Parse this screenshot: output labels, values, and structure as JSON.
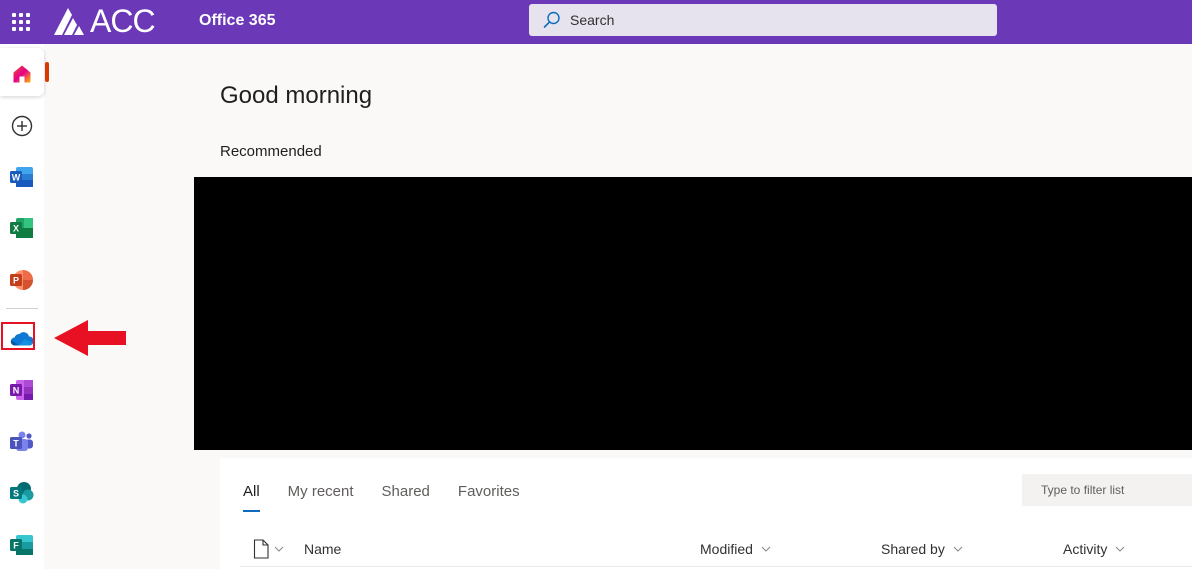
{
  "header": {
    "logo_text": "ACC",
    "app_name": "Office 365",
    "search_placeholder": "Search",
    "background_color": "#6b38b8"
  },
  "rail": {
    "items": [
      {
        "name": "home",
        "icon": "home-icon"
      },
      {
        "name": "create",
        "icon": "add-circle-icon"
      },
      {
        "name": "word",
        "icon": "word-icon",
        "letter": "W",
        "color": "#185abd"
      },
      {
        "name": "excel",
        "icon": "excel-icon",
        "letter": "X",
        "color": "#107c41"
      },
      {
        "name": "powerpoint",
        "icon": "powerpoint-icon",
        "letter": "P",
        "color": "#c43e1c"
      },
      {
        "name": "onedrive",
        "icon": "onedrive-icon",
        "color": "#0f78d4"
      },
      {
        "name": "onenote",
        "icon": "onenote-icon",
        "letter": "N",
        "color": "#7719aa"
      },
      {
        "name": "teams",
        "icon": "teams-icon",
        "color": "#5b5fc7"
      },
      {
        "name": "sharepoint",
        "icon": "sharepoint-icon",
        "letter": "S",
        "color": "#038387"
      },
      {
        "name": "forms",
        "icon": "forms-icon",
        "letter": "F",
        "color": "#077568"
      }
    ]
  },
  "main": {
    "greeting": "Good morning",
    "recommended_label": "Recommended"
  },
  "files": {
    "tabs": [
      {
        "label": "All",
        "active": true
      },
      {
        "label": "My recent",
        "active": false
      },
      {
        "label": "Shared",
        "active": false
      },
      {
        "label": "Favorites",
        "active": false
      }
    ],
    "filter_placeholder": "Type to filter list",
    "columns": {
      "name": "Name",
      "modified": "Modified",
      "shared_by": "Shared by",
      "activity": "Activity"
    }
  },
  "annotation": {
    "highlight_color": "#e81123"
  }
}
